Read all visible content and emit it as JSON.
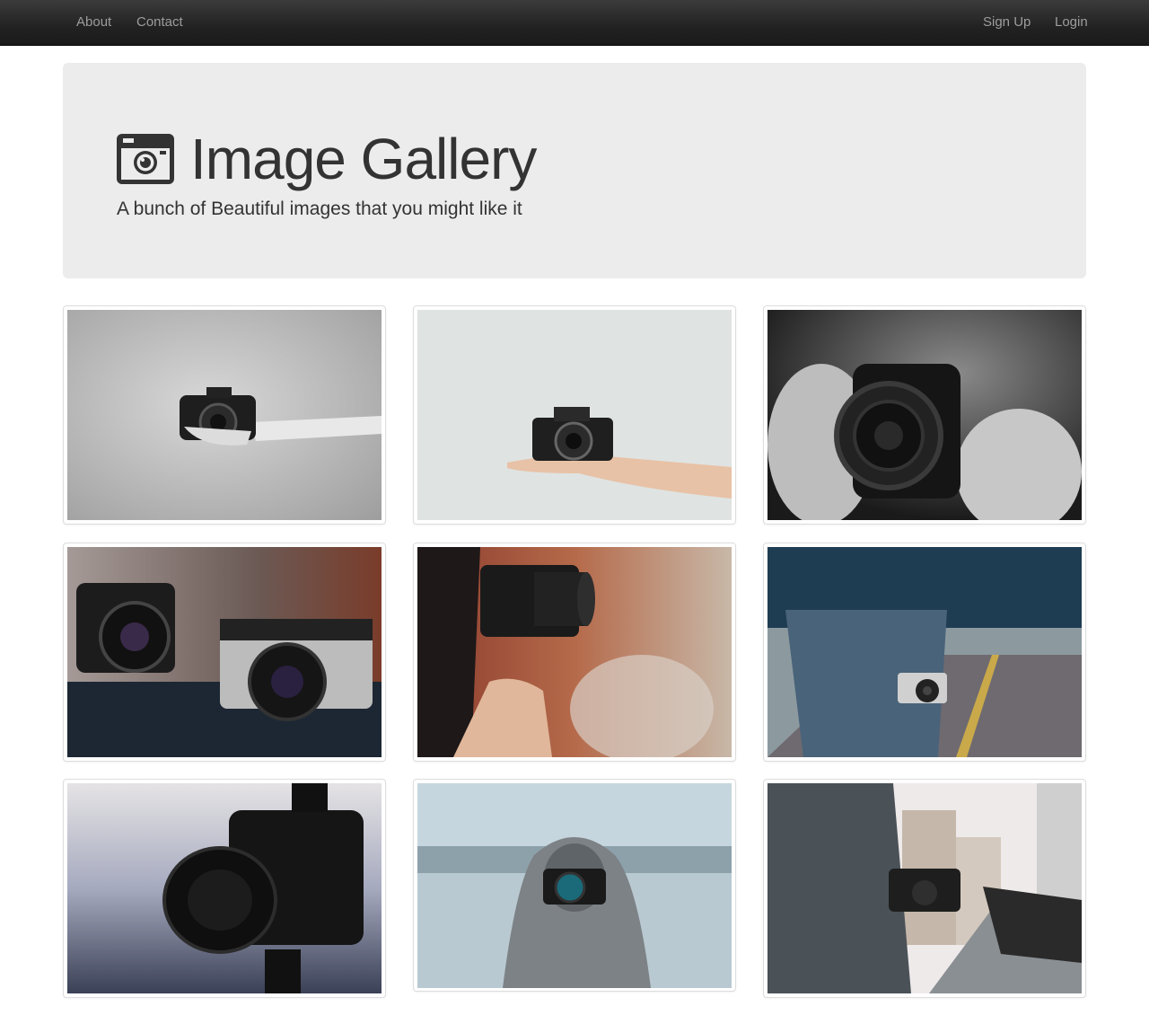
{
  "nav": {
    "left_links": [
      "About",
      "Contact"
    ],
    "right_links": [
      "Sign Up",
      "Login"
    ]
  },
  "header": {
    "icon": "camera-icon",
    "title": "Image Gallery",
    "subtitle": "A bunch of Beautiful images that you might like it"
  },
  "gallery": {
    "images": [
      {
        "name": "gallery-image-hand-nikon-grayscale"
      },
      {
        "name": "gallery-image-palm-nikon"
      },
      {
        "name": "gallery-image-canon-lens-closeup"
      },
      {
        "name": "gallery-image-nikon-canon-table"
      },
      {
        "name": "gallery-image-woman-dslr-side"
      },
      {
        "name": "gallery-image-man-rangefinder-road"
      },
      {
        "name": "gallery-image-canon-hood-lens"
      },
      {
        "name": "gallery-image-hooded-photographer-snow"
      },
      {
        "name": "gallery-image-street-photographer-city"
      }
    ]
  }
}
